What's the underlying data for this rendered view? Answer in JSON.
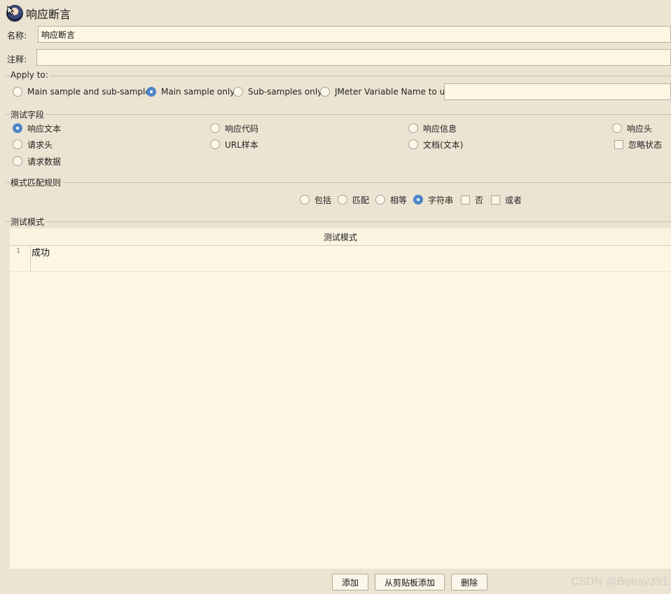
{
  "header": {
    "title": "响应断言"
  },
  "fields": {
    "name_label": "名称:",
    "name_value": "响应断言",
    "comment_label": "注释:",
    "comment_value": ""
  },
  "apply_to": {
    "title": "Apply to:",
    "options": [
      {
        "label": "Main sample and sub-samples",
        "checked": false
      },
      {
        "label": "Main sample only",
        "checked": true
      },
      {
        "label": "Sub-samples only",
        "checked": false
      },
      {
        "label": "JMeter Variable Name to use",
        "checked": false
      }
    ],
    "variable_value": ""
  },
  "test_field": {
    "title": "测试字段",
    "options": [
      {
        "label": "响应文本",
        "checked": true
      },
      {
        "label": "响应代码",
        "checked": false
      },
      {
        "label": "响应信息",
        "checked": false
      },
      {
        "label": "响应头",
        "checked": false
      },
      {
        "label": "请求头",
        "checked": false
      },
      {
        "label": "URL样本",
        "checked": false
      },
      {
        "label": "文档(文本)",
        "checked": false
      },
      {
        "label": "忽略状态",
        "checked": false
      },
      {
        "label": "请求数据",
        "checked": false
      }
    ]
  },
  "pattern_rule": {
    "title": "模式匹配规则",
    "options": [
      {
        "label": "包括",
        "checked": false
      },
      {
        "label": "匹配",
        "checked": false
      },
      {
        "label": "相等",
        "checked": false
      },
      {
        "label": "字符串",
        "checked": true
      },
      {
        "label": "否",
        "checked": false
      },
      {
        "label": "或者",
        "checked": false
      }
    ]
  },
  "test_pattern": {
    "title": "测试模式",
    "column_header": "测试模式",
    "rows": [
      {
        "num": "1",
        "value": "成功"
      }
    ]
  },
  "buttons": {
    "add": "添加",
    "add_from_clipboard": "从剪贴板添加",
    "delete": "删除"
  },
  "watermark": "CSDN @Betray391",
  "colors": {
    "accent": "#4f86c6",
    "panel": "#ece4d2",
    "field": "#fdf6e4"
  }
}
